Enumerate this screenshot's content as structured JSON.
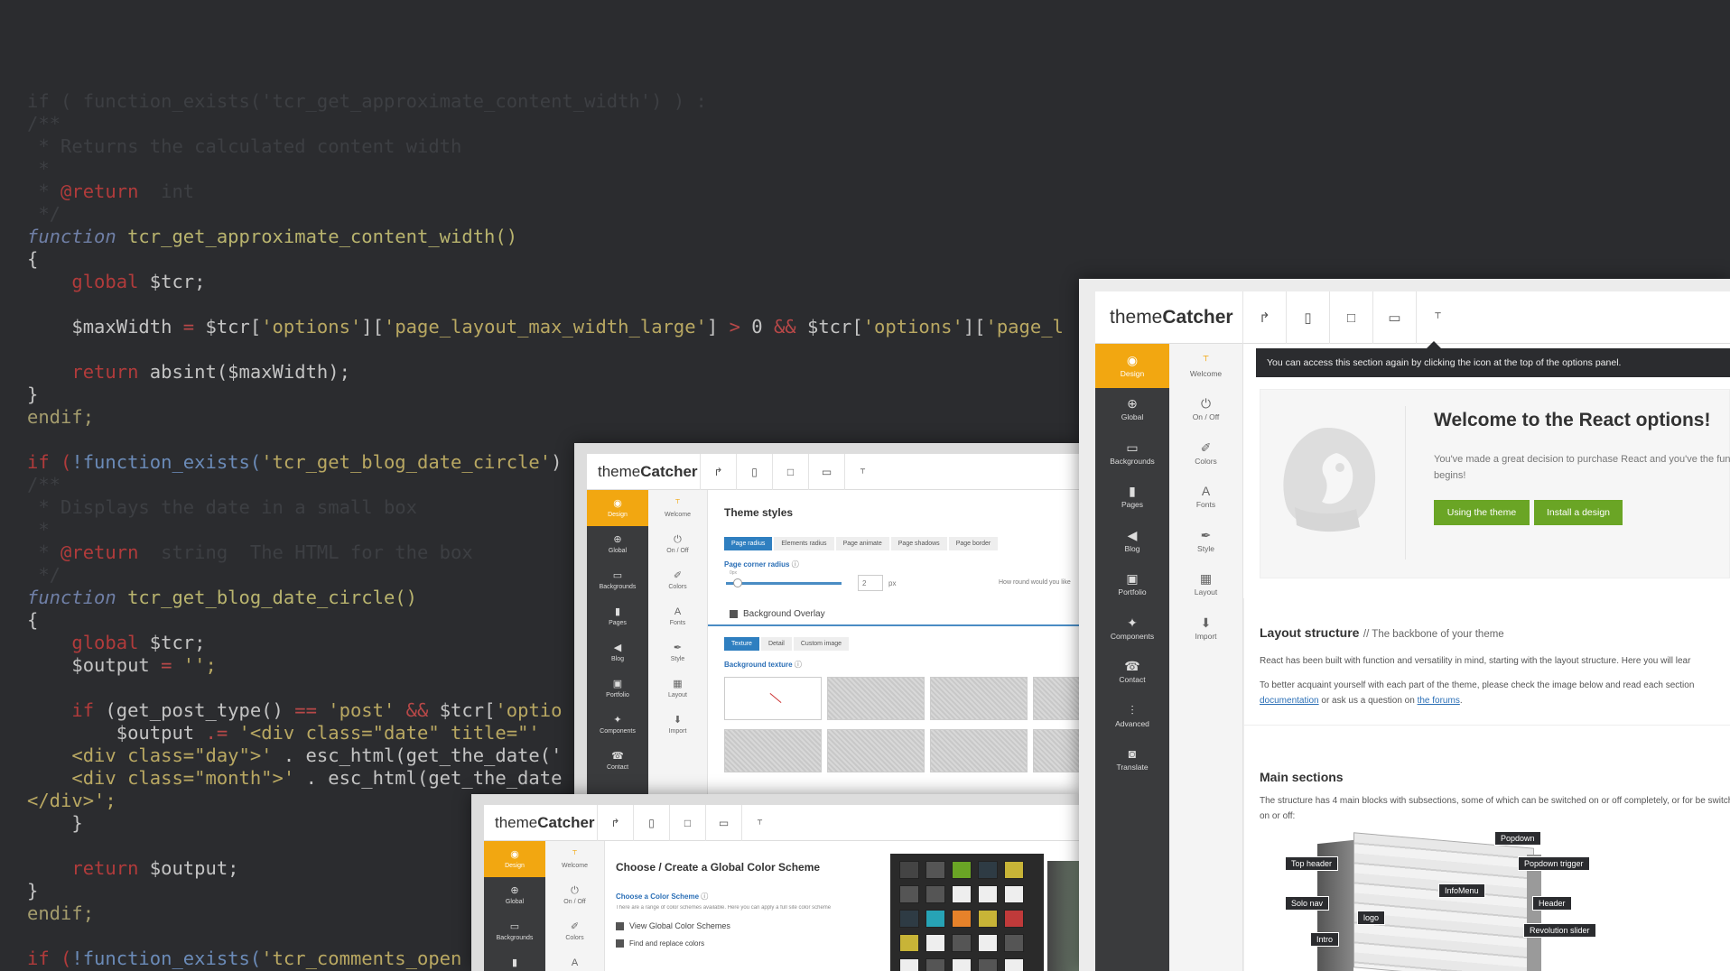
{
  "code_lines": [
    [
      [
        "if ( function_exists('tcr_get_approximate_content_width') ) :",
        "cm"
      ]
    ],
    [
      [
        "/**",
        "cm"
      ]
    ],
    [
      [
        " * Returns the calculated content width",
        "cm"
      ]
    ],
    [
      [
        " *",
        "cm"
      ]
    ],
    [
      [
        " * ",
        "cm"
      ],
      [
        "@return",
        "rd"
      ],
      [
        "  int",
        "cm"
      ]
    ],
    [
      [
        " */",
        "cm"
      ]
    ],
    [
      [
        "function",
        "kw"
      ],
      [
        " tcr_get_approximate_content_width()",
        "fn"
      ]
    ],
    [
      [
        "{",
        ""
      ]
    ],
    [
      [
        "    ",
        ""
      ],
      [
        "global",
        "rd"
      ],
      [
        " $tcr;",
        ""
      ]
    ],
    [
      [
        "",
        ""
      ]
    ],
    [
      [
        "    $maxWidth ",
        ""
      ],
      [
        "=",
        "op"
      ],
      [
        " $tcr[",
        ""
      ],
      [
        "'options'",
        "st"
      ],
      [
        "][",
        ""
      ],
      [
        "'page_layout_max_width_large'",
        "st"
      ],
      [
        "] ",
        ""
      ],
      [
        ">",
        "op"
      ],
      [
        " 0 ",
        ""
      ],
      [
        "&&",
        "op"
      ],
      [
        " $tcr[",
        ""
      ],
      [
        "'options'",
        "st"
      ],
      [
        "][",
        ""
      ],
      [
        "'page_l",
        "st"
      ]
    ],
    [
      [
        "",
        ""
      ]
    ],
    [
      [
        "    ",
        ""
      ],
      [
        "return",
        "rd"
      ],
      [
        " absint($maxWidth);",
        ""
      ]
    ],
    [
      [
        "}",
        ""
      ]
    ],
    [
      [
        "endif;",
        "pl"
      ]
    ],
    [
      [
        "",
        ""
      ]
    ],
    [
      [
        "if (",
        "rd"
      ],
      [
        "!function_exists(",
        "bl"
      ],
      [
        "'tcr_get_blog_date_circle'",
        "st"
      ],
      [
        ")",
        ""
      ]
    ],
    [
      [
        "/**",
        "cm"
      ]
    ],
    [
      [
        " * Displays the date in a small box",
        "cm"
      ]
    ],
    [
      [
        " *",
        "cm"
      ]
    ],
    [
      [
        " * ",
        "cm"
      ],
      [
        "@return",
        "rd"
      ],
      [
        "  string  The HTML for the box",
        "cm"
      ]
    ],
    [
      [
        " */",
        "cm"
      ]
    ],
    [
      [
        "function",
        "kw"
      ],
      [
        " tcr_get_blog_date_circle()",
        "fn"
      ]
    ],
    [
      [
        "{",
        ""
      ]
    ],
    [
      [
        "    ",
        ""
      ],
      [
        "global",
        "rd"
      ],
      [
        " $tcr;",
        ""
      ]
    ],
    [
      [
        "    $output ",
        ""
      ],
      [
        "=",
        "op"
      ],
      [
        " '';",
        "st"
      ]
    ],
    [
      [
        "",
        ""
      ]
    ],
    [
      [
        "    ",
        ""
      ],
      [
        "if",
        "rd"
      ],
      [
        " (get_post_type() ",
        ""
      ],
      [
        "==",
        "op"
      ],
      [
        " 'post' ",
        "st"
      ],
      [
        "&&",
        "op"
      ],
      [
        " $tcr[",
        ""
      ],
      [
        "'optio",
        "st"
      ]
    ],
    [
      [
        "        $output ",
        ""
      ],
      [
        ".=",
        "op"
      ],
      [
        " '<div class=\"date\" title=\"' ",
        "st"
      ]
    ],
    [
      [
        "    <div class=\"day\">' ",
        "st"
      ],
      [
        ". esc_html(get_the_date('",
        ""
      ]
    ],
    [
      [
        "    <div class=\"month\">' ",
        "st"
      ],
      [
        ". esc_html(get_the_date",
        ""
      ]
    ],
    [
      [
        "</div>';",
        "st"
      ]
    ],
    [
      [
        "    }",
        ""
      ]
    ],
    [
      [
        "",
        ""
      ]
    ],
    [
      [
        "    ",
        ""
      ],
      [
        "return",
        "rd"
      ],
      [
        " $output;",
        ""
      ]
    ],
    [
      [
        "}",
        ""
      ]
    ],
    [
      [
        "endif;",
        "pl"
      ]
    ],
    [
      [
        "",
        ""
      ]
    ],
    [
      [
        "if (",
        "rd"
      ],
      [
        "!function_exists(",
        "bl"
      ],
      [
        "'tcr_comments_open",
        "st"
      ]
    ]
  ],
  "brand": {
    "light": "theme",
    "bold": "Catcher"
  },
  "nav_primary": [
    {
      "label": "Design",
      "icon": "eye-icon",
      "glyph": "◉"
    },
    {
      "label": "Global",
      "icon": "globe-icon",
      "glyph": "⊕"
    },
    {
      "label": "Backgrounds",
      "icon": "monitor-icon",
      "glyph": "▭"
    },
    {
      "label": "Pages",
      "icon": "page-icon",
      "glyph": "▮"
    },
    {
      "label": "Blog",
      "icon": "megaphone-icon",
      "glyph": "◀"
    },
    {
      "label": "Portfolio",
      "icon": "portfolio-icon",
      "glyph": "▣"
    },
    {
      "label": "Components",
      "icon": "components-icon",
      "glyph": "✦"
    },
    {
      "label": "Contact",
      "icon": "phone-icon",
      "glyph": "☎"
    },
    {
      "label": "Advanced",
      "icon": "sliders-icon",
      "glyph": "⫶"
    },
    {
      "label": "Translate",
      "icon": "speech-icon",
      "glyph": "◙"
    }
  ],
  "nav_secondary": [
    {
      "label": "Welcome",
      "icon": "welcome-icon",
      "glyph": "⸆"
    },
    {
      "label": "On / Off",
      "icon": "power-icon",
      "glyph": "⏻"
    },
    {
      "label": "Colors",
      "icon": "dropper-icon",
      "glyph": "✐"
    },
    {
      "label": "Fonts",
      "icon": "font-icon",
      "glyph": "A"
    },
    {
      "label": "Style",
      "icon": "brush-icon",
      "glyph": "✒"
    },
    {
      "label": "Layout",
      "icon": "layout-icon",
      "glyph": "▦"
    },
    {
      "label": "Import",
      "icon": "import-icon",
      "glyph": "⬇"
    }
  ],
  "toolbar_icons": [
    {
      "name": "undo-icon",
      "glyph": "↱"
    },
    {
      "name": "mobile-icon",
      "glyph": "▯"
    },
    {
      "name": "tablet-icon",
      "glyph": "□"
    },
    {
      "name": "desktop-icon",
      "glyph": "▭"
    },
    {
      "name": "welcome-icon",
      "glyph": "⸆"
    }
  ],
  "main": {
    "tooltip": "You can access this section again by clicking the icon at the top of the options panel.",
    "welcome_title": "Welcome to the React options!",
    "welcome_text": "You've made a great decision to purchase React and you've the fun begins!",
    "btn_using": "Using the theme",
    "btn_install": "Install a design",
    "layout_title": "Layout structure",
    "layout_sub": "// The backbone of your theme",
    "layout_p1": "React has been built with function and versatility in mind, starting with the layout structure. Here you will lear",
    "layout_p2": "To better acquaint yourself with each part of the theme, please check the image below and read each section",
    "link_doc": "documentation",
    "mid_text": " or ask us a question on ",
    "link_forums": "the forums",
    "link_end": ".",
    "main_sections_title": "Main sections",
    "main_sections_text": "The structure has 4 main blocks with subsections, some of which can be switched on or off completely, or for be switched on or off:",
    "diagram_labels": [
      "Popdown",
      "Top header",
      "Popdown trigger",
      "InfoMenu",
      "Solo nav",
      "Header",
      "logo",
      "Revolution slider",
      "Intro"
    ]
  },
  "theme_styles": {
    "title": "Theme styles",
    "tabs": [
      "Page radius",
      "Elements radius",
      "Page animate",
      "Page shadows",
      "Page border"
    ],
    "field_label": "Page corner radius",
    "slider_min": "0px",
    "value": "2",
    "unit": "px",
    "hint": "How round would you like",
    "overlay_label": "Background Overlay",
    "tabs2": [
      "Texture",
      "Detail",
      "Custom image"
    ],
    "texture_label": "Background texture"
  },
  "color_scheme": {
    "title": "Choose / Create a Global Color Scheme",
    "field": "Choose a Color Scheme",
    "desc": "There are a range of color schemes available. Here you can apply a full site color scheme",
    "check1": "View Global Color Schemes",
    "check2": "Find and replace colors",
    "swatches": [
      "#444",
      "#555",
      "#6aa525",
      "#2e3b44",
      "#c8b437",
      "#555",
      "#555",
      "#eee",
      "#eee",
      "#eee",
      "#2e3b44",
      "#27a3b5",
      "#e6822a",
      "#c8b437",
      "#c03a3a",
      "#c8b437",
      "#eee",
      "#555",
      "#eee",
      "#555",
      "#eee",
      "#555",
      "#eee",
      "#555",
      "#eee"
    ]
  }
}
